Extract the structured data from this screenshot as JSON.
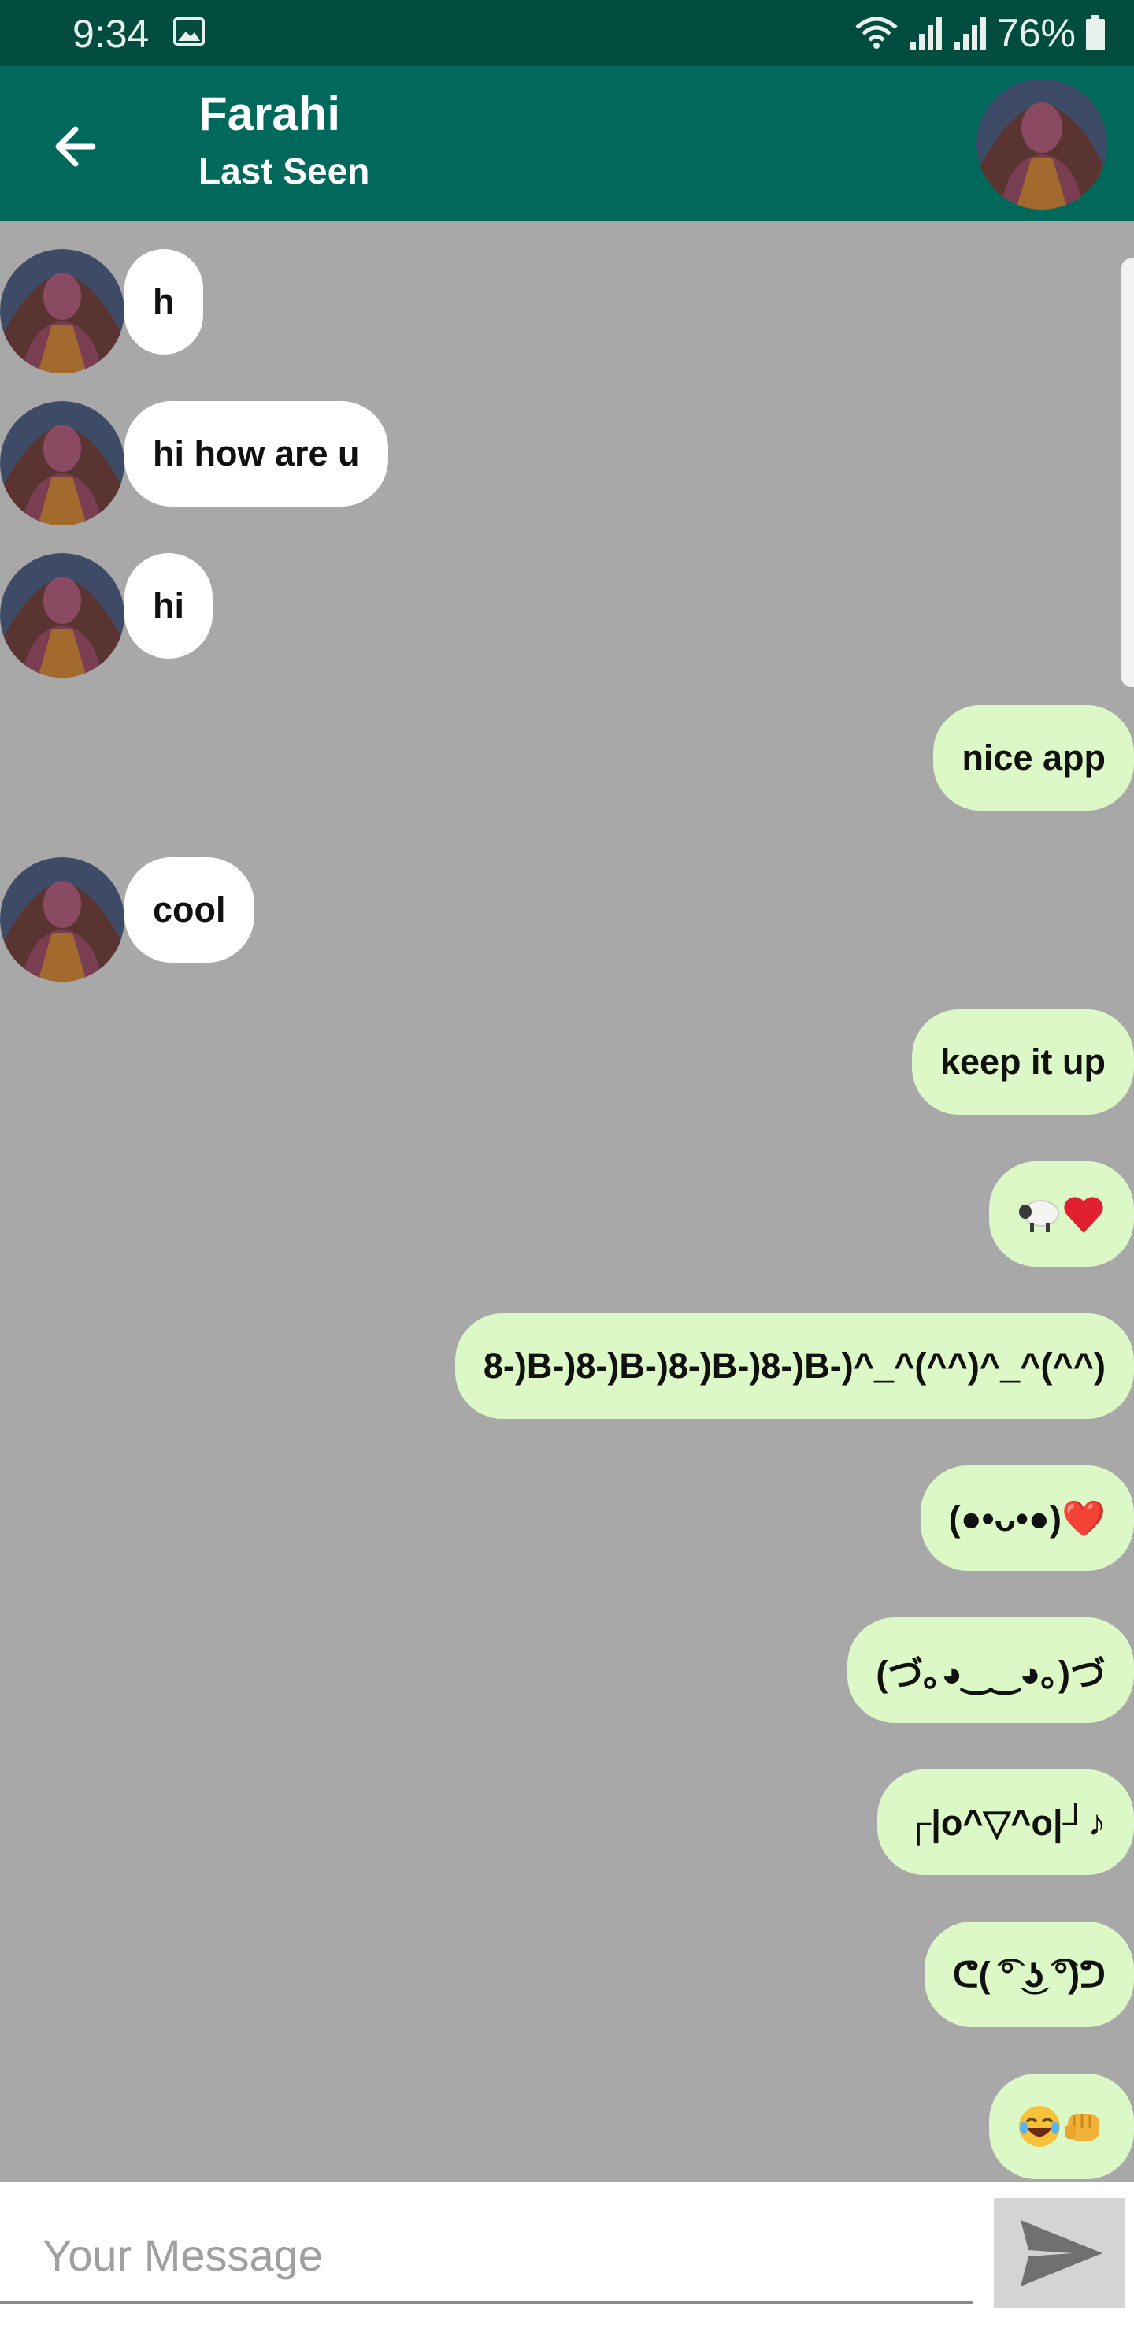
{
  "status_bar": {
    "time": "9:34",
    "battery": "76%"
  },
  "header": {
    "title": "Farahi",
    "subtitle": "Last Seen"
  },
  "colors": {
    "status_bar": "#004d40",
    "app_bar": "#00695c",
    "chat_background": "#a8a8a8",
    "incoming_bubble": "#ffffff",
    "outgoing_bubble": "#dcf8c6"
  },
  "messages": [
    {
      "direction": "incoming",
      "text": "h"
    },
    {
      "direction": "incoming",
      "text": "hi how are u"
    },
    {
      "direction": "incoming",
      "text": "hi"
    },
    {
      "direction": "outgoing",
      "text": "nice app"
    },
    {
      "direction": "incoming",
      "text": "cool"
    },
    {
      "direction": "outgoing",
      "text": "keep it up"
    },
    {
      "direction": "outgoing",
      "text": "🐑❤️"
    },
    {
      "direction": "outgoing",
      "text": "8-)B-)8-)B-)8-)B-)8-)B-)^_^(^^)^_^(^^)"
    },
    {
      "direction": "outgoing",
      "text": "(●•ᴗ•●)❤️"
    },
    {
      "direction": "outgoing",
      "text": "(づ｡◕‿‿◕｡)づ"
    },
    {
      "direction": "outgoing",
      "text": "┌|o^▽^o|┘♪"
    },
    {
      "direction": "outgoing",
      "text": "ᕦ( ͡° ͜ʖ ͡°)ᕤ"
    },
    {
      "direction": "outgoing",
      "text": "😂👊"
    }
  ],
  "composer": {
    "placeholder": "Your Message"
  }
}
